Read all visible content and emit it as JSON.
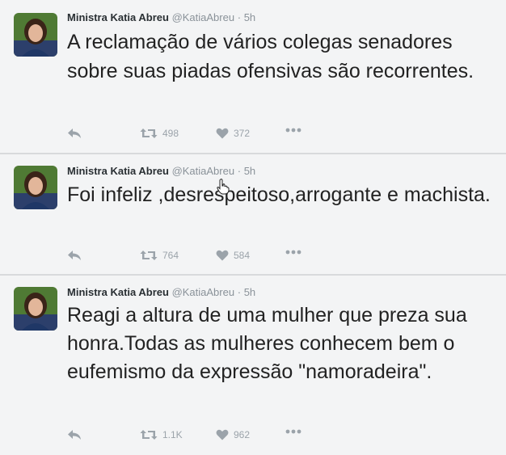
{
  "tweets": [
    {
      "name": "Ministra Katia Abreu",
      "handle": "@KatiaAbreu",
      "separator": "·",
      "time": "5h",
      "text": "A reclamação de vários colegas senadores sobre suas piadas ofensivas são recorrentes.",
      "retweets": "498",
      "likes": "372"
    },
    {
      "name": "Ministra Katia Abreu",
      "handle": "@KatiaAbreu",
      "separator": "·",
      "time": "5h",
      "text": "Foi infeliz ,desrespeitoso,arrogante e machista.",
      "retweets": "764",
      "likes": "584"
    },
    {
      "name": "Ministra Katia Abreu",
      "handle": "@KatiaAbreu",
      "separator": "·",
      "time": "5h",
      "text": "Reagi a altura de uma mulher que preza sua honra.Todas as mulheres conhecem bem o eufemismo da expressão \"namoradeira\".",
      "retweets": "1.1K",
      "likes": "962"
    }
  ],
  "icons": {
    "reply": "reply-icon",
    "retweet": "retweet-icon",
    "like": "heart-icon",
    "more": "more-icon",
    "cursor": "hand-cursor-icon"
  },
  "colors": {
    "background": "#f3f4f5",
    "text": "#222222",
    "meta": "#8a9299",
    "icon": "#9ba3aa"
  }
}
